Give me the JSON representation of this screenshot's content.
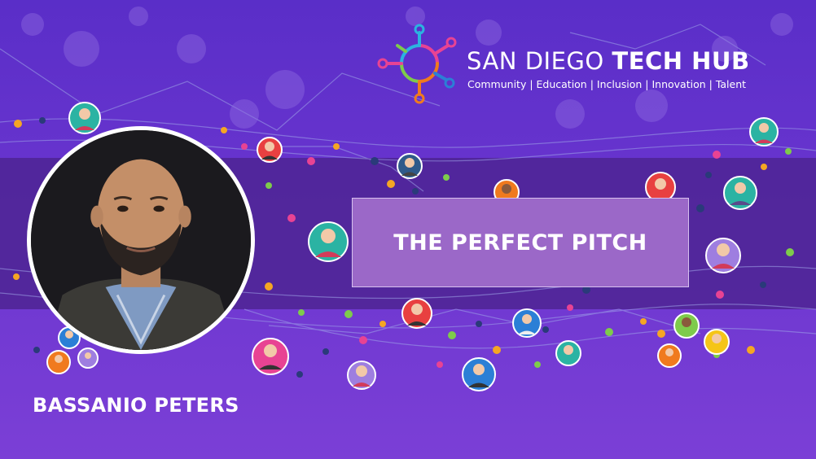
{
  "logo": {
    "title_light": "SAN DIEGO ",
    "title_bold": "TECH HUB",
    "tagline": "Community |  Education  |  Inclusion   |   Innovation  |  Talent"
  },
  "banner": {
    "title": "THE PERFECT PITCH"
  },
  "speaker": {
    "name": "BASSANIO PETERS"
  },
  "colors": {
    "background": "#6a35cf",
    "band": "#4e2593",
    "title_box": "#9b68c8"
  },
  "icons": [
    "network-avatar-icon",
    "tech-hub-logo-icon",
    "speaker-photo"
  ]
}
